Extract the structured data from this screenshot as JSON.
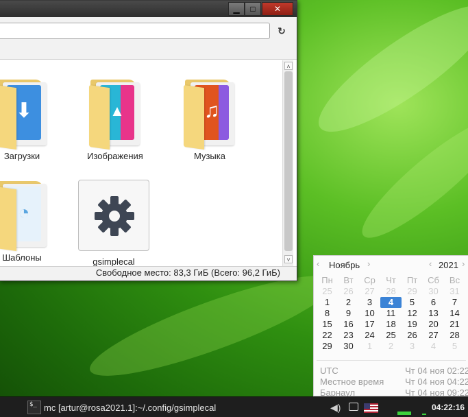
{
  "window": {
    "minimize": "▁",
    "maximize": "□",
    "close": "✕",
    "path_value": "",
    "reload_icon": "↻",
    "status": "Свободное место: 83,3 ГиБ (Всего: 96,2 ГиБ)",
    "items": [
      {
        "label": "Загрузки",
        "icon": "downloads-folder-icon",
        "card_color": "#3d8fe0",
        "glyph": "⬇"
      },
      {
        "label": "Изображения",
        "icon": "pictures-folder-icon",
        "card_color": "#29b6d6",
        "glyph": "🖼"
      },
      {
        "label": "Музыка",
        "icon": "music-folder-icon",
        "card_color": "#e0541f",
        "glyph": "♫"
      },
      {
        "label": "Шаблоны",
        "icon": "templates-folder-icon",
        "card_color": "#c8e4f7",
        "glyph": ""
      },
      {
        "label": "gsimplecal",
        "icon": "gear-icon"
      }
    ]
  },
  "calendar": {
    "month": "Ноябрь",
    "year": "2021",
    "weekdays": [
      "Пн",
      "Вт",
      "Ср",
      "Чт",
      "Пт",
      "Сб",
      "Вс"
    ],
    "weeks": [
      [
        "25",
        "26",
        "27",
        "28",
        "29",
        "30",
        "31"
      ],
      [
        "1",
        "2",
        "3",
        "4",
        "5",
        "6",
        "7"
      ],
      [
        "8",
        "9",
        "10",
        "11",
        "12",
        "13",
        "14"
      ],
      [
        "15",
        "16",
        "17",
        "18",
        "19",
        "20",
        "21"
      ],
      [
        "22",
        "23",
        "24",
        "25",
        "26",
        "27",
        "28"
      ],
      [
        "29",
        "30",
        "1",
        "2",
        "3",
        "4",
        "5"
      ]
    ],
    "today": "4",
    "timezones": [
      {
        "name": "UTC",
        "time": "Чт 04 ноя 02:22"
      },
      {
        "name": "Местное время",
        "time": "Чт 04 ноя 04:22"
      },
      {
        "name": "Барнаул",
        "time": "Чт 04 ноя 09:22"
      }
    ]
  },
  "taskbar": {
    "terminal_icon_text": "$_",
    "task_title": "mc [artur@rosa2021.1]:~/.config/gsimplecal",
    "clock": "04:22:16",
    "accent_green": "#3dd13d"
  }
}
